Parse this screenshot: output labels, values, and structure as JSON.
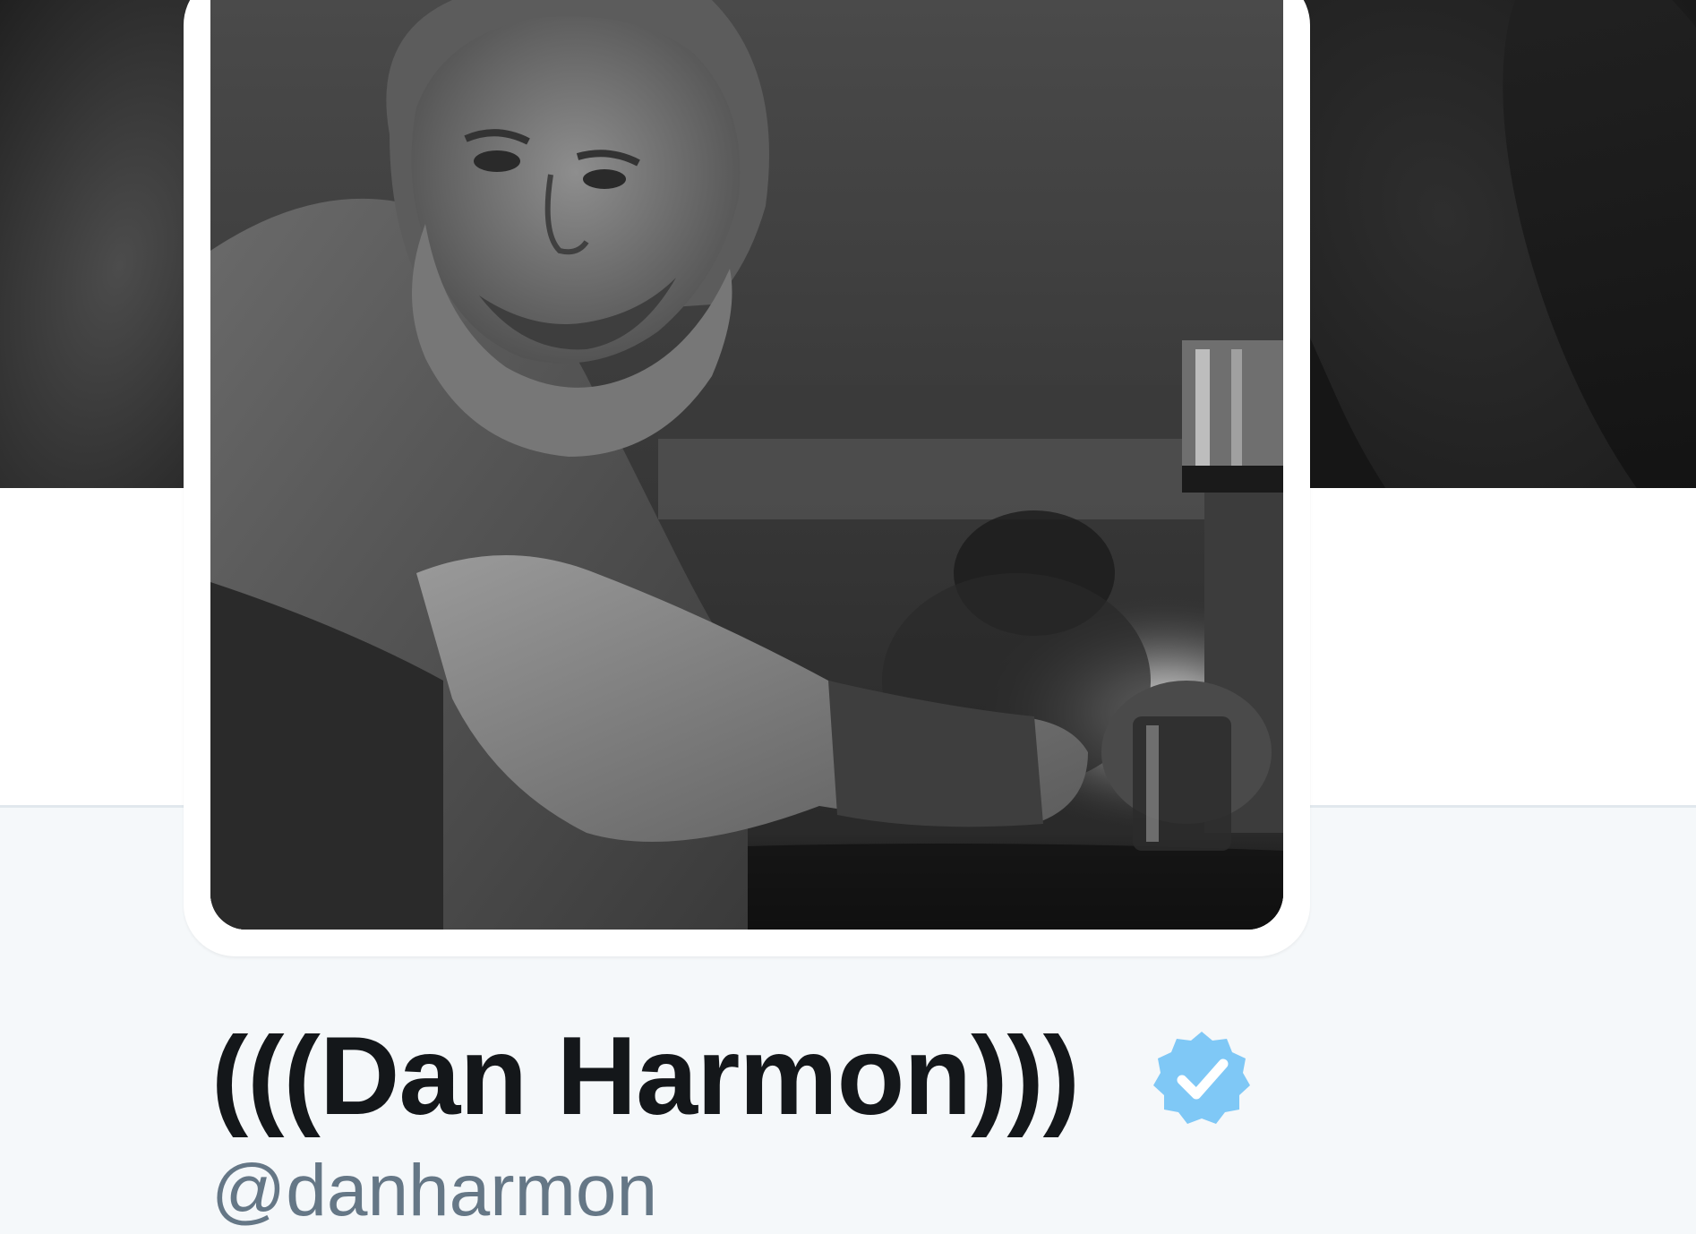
{
  "header": {
    "banner_icon": "cover-photo"
  },
  "profile": {
    "avatar_icon": "profile-photo",
    "name": "(((Dan Harmon)))",
    "verified_icon": "verified-badge-icon",
    "screen_name": "@danharmon"
  },
  "colors": {
    "text_primary": "#14171a",
    "text_secondary": "#657786",
    "verified_blue": "#1da1f2",
    "page_background": "#f5f8fa",
    "divider": "#e1e8ed"
  }
}
